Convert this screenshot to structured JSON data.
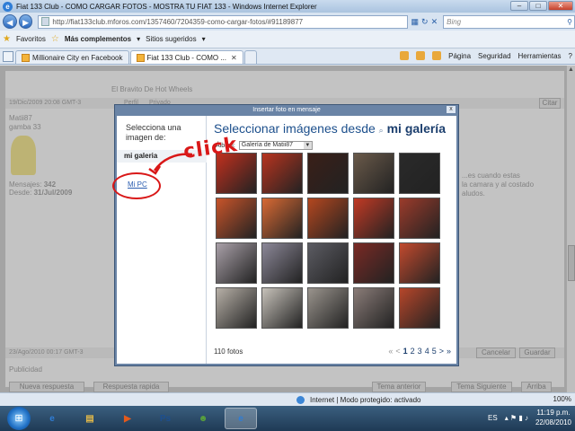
{
  "window": {
    "title": "Fiat 133 Club - COMO CARGAR FOTOS - MOSTRA TU FIAT 133 - Windows Internet Explorer",
    "minimize": "–",
    "maximize": "□",
    "close": "✕"
  },
  "address_bar": {
    "url": "http://fiat133club.mforos.com/1357460/7204359-como-cargar-fotos/#91189877",
    "search_engine": "Bing"
  },
  "favorites_bar": {
    "favorites": "Favoritos",
    "more_addons": "Más complementos",
    "suggested_sites": "Sitios sugeridos"
  },
  "tabs": [
    {
      "label": "Millionaire City en Facebook"
    },
    {
      "label": "Fiat 133 Club - COMO ..."
    }
  ],
  "command_bar": {
    "page": "Página",
    "security": "Seguridad",
    "tools": "Herramientas"
  },
  "page_bg": {
    "post1_date": "19/Dic/2009 20:08 GMT-3",
    "user": "Matii87",
    "rank": "gamba 33",
    "messages_label": "Mensajes:",
    "messages_count": "342",
    "since_label": "Desde:",
    "since_date": "31/Jul/2009",
    "signature": "El Bravito De Hot Wheels",
    "profile": "Perfil",
    "private": "Privado",
    "cite": "Citar",
    "body_snippet1": "...es cuando estas",
    "body_snippet2": "la camara y al costado",
    "body_snippet3": "aludos.",
    "post2_date": "23/Ago/2010 00:17 GMT-3",
    "cancel": "Cancelar",
    "save": "Guardar",
    "publicity": "Publicidad",
    "new_reply": "Nueva respuesta",
    "quick_reply": "Respuesta rapida",
    "prev_topic": "Tema anterior",
    "next_topic": "Tema Siguiente",
    "top": "Arriba"
  },
  "modal": {
    "header": "Insertar foto en mensaje",
    "close": "x",
    "select_from": "Selecciona una imagen de:",
    "my_gallery_option": "mi galeria",
    "my_pc_option": "Mi PC",
    "title_prefix": "Seleccionar imágenes desde",
    "title_gallery": "mi galería",
    "filter_label": "Álbum:",
    "filter_value": "Galería de Matii87",
    "photo_count": "110 fotos",
    "pager": {
      "first": "«",
      "prev": "<",
      "pages": [
        "1",
        "2",
        "3",
        "4",
        "5"
      ],
      "next": ">",
      "last": "»"
    },
    "thumbnails": [
      {
        "bg": "#c1301e"
      },
      {
        "bg": "#b8341f"
      },
      {
        "bg": "#3a1f18"
      },
      {
        "bg": "#6a5a4a"
      },
      {
        "bg": "#2a2a2a"
      },
      {
        "bg": "#c8542a"
      },
      {
        "bg": "#d96a34"
      },
      {
        "bg": "#b4471f"
      },
      {
        "bg": "#c23a25"
      },
      {
        "bg": "#9b3b2b"
      },
      {
        "bg": "#a9a0a8"
      },
      {
        "bg": "#8c8898"
      },
      {
        "bg": "#5c5c63"
      },
      {
        "bg": "#7a2a25"
      },
      {
        "bg": "#c24a2e"
      },
      {
        "bg": "#b7b0a7"
      },
      {
        "bg": "#c7c2ba"
      },
      {
        "bg": "#9a948d"
      },
      {
        "bg": "#8a7c78"
      },
      {
        "bg": "#b6462a"
      }
    ]
  },
  "annotation": {
    "text": "click",
    "color": "#d91818"
  },
  "status_bar": {
    "zone": "Internet | Modo protegido: activado",
    "zoom": "100%"
  },
  "taskbar": {
    "language": "ES",
    "time": "11:19 p.m.",
    "date": "22/08/2010",
    "apps": [
      {
        "label": "e",
        "color": "#2f7dd6"
      },
      {
        "label": "▤",
        "color": "#e0b84a"
      },
      {
        "label": "▶",
        "color": "#e35a1c"
      },
      {
        "label": "Ps",
        "color": "#1d4f8f"
      },
      {
        "label": "☻",
        "color": "#5aa33a"
      },
      {
        "label": "e",
        "color": "#2f7dd6"
      }
    ]
  }
}
